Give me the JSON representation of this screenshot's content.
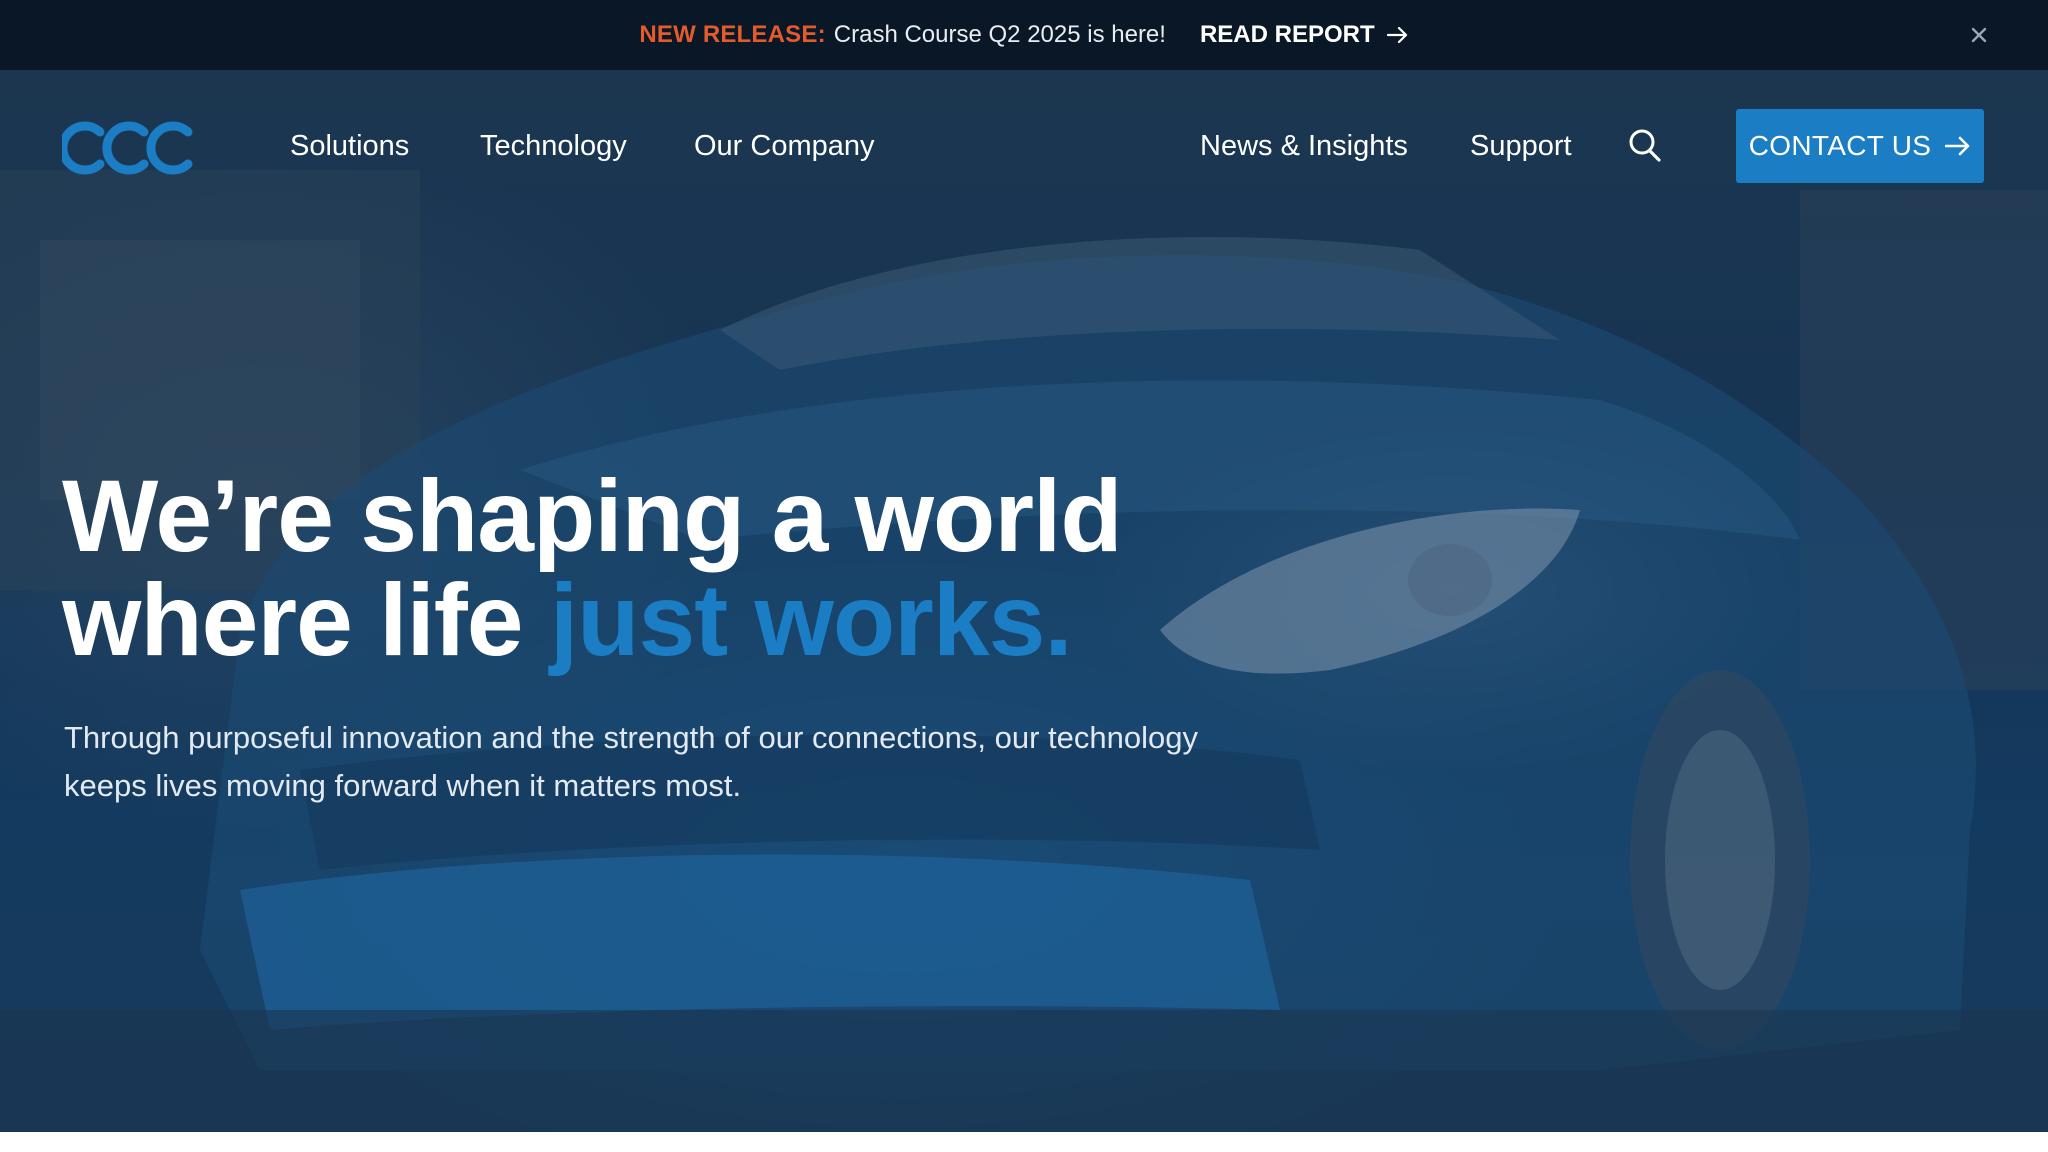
{
  "announcement": {
    "tag": "NEW RELEASE:",
    "message": "Crash Course Q2 2025 is here!",
    "cta_label": "READ REPORT",
    "cta_icon": "arrow-right-icon",
    "close_icon": "close-icon"
  },
  "nav": {
    "logo_icon": "ccc-logo",
    "items": [
      {
        "label": "Solutions"
      },
      {
        "label": "Technology"
      },
      {
        "label": "Our Company"
      },
      {
        "label": "News & Insights"
      },
      {
        "label": "Support"
      }
    ],
    "search_icon": "search-icon",
    "contact_label": "CONTACT US",
    "contact_icon": "arrow-right-icon"
  },
  "hero": {
    "headline_line1": "We’re shaping a world",
    "headline_line2_plain": "where life ",
    "headline_line2_accent": "just works.",
    "subtext_line1": "Through purposeful innovation and the strength of our connections, our technology",
    "subtext_line2": "keeps lives moving forward when it matters most."
  },
  "colors": {
    "announcement_bg": "#0a1726",
    "tag_color": "#e35a2b",
    "accent_blue": "#1b7ec5",
    "hero_overlay": "#163453"
  }
}
